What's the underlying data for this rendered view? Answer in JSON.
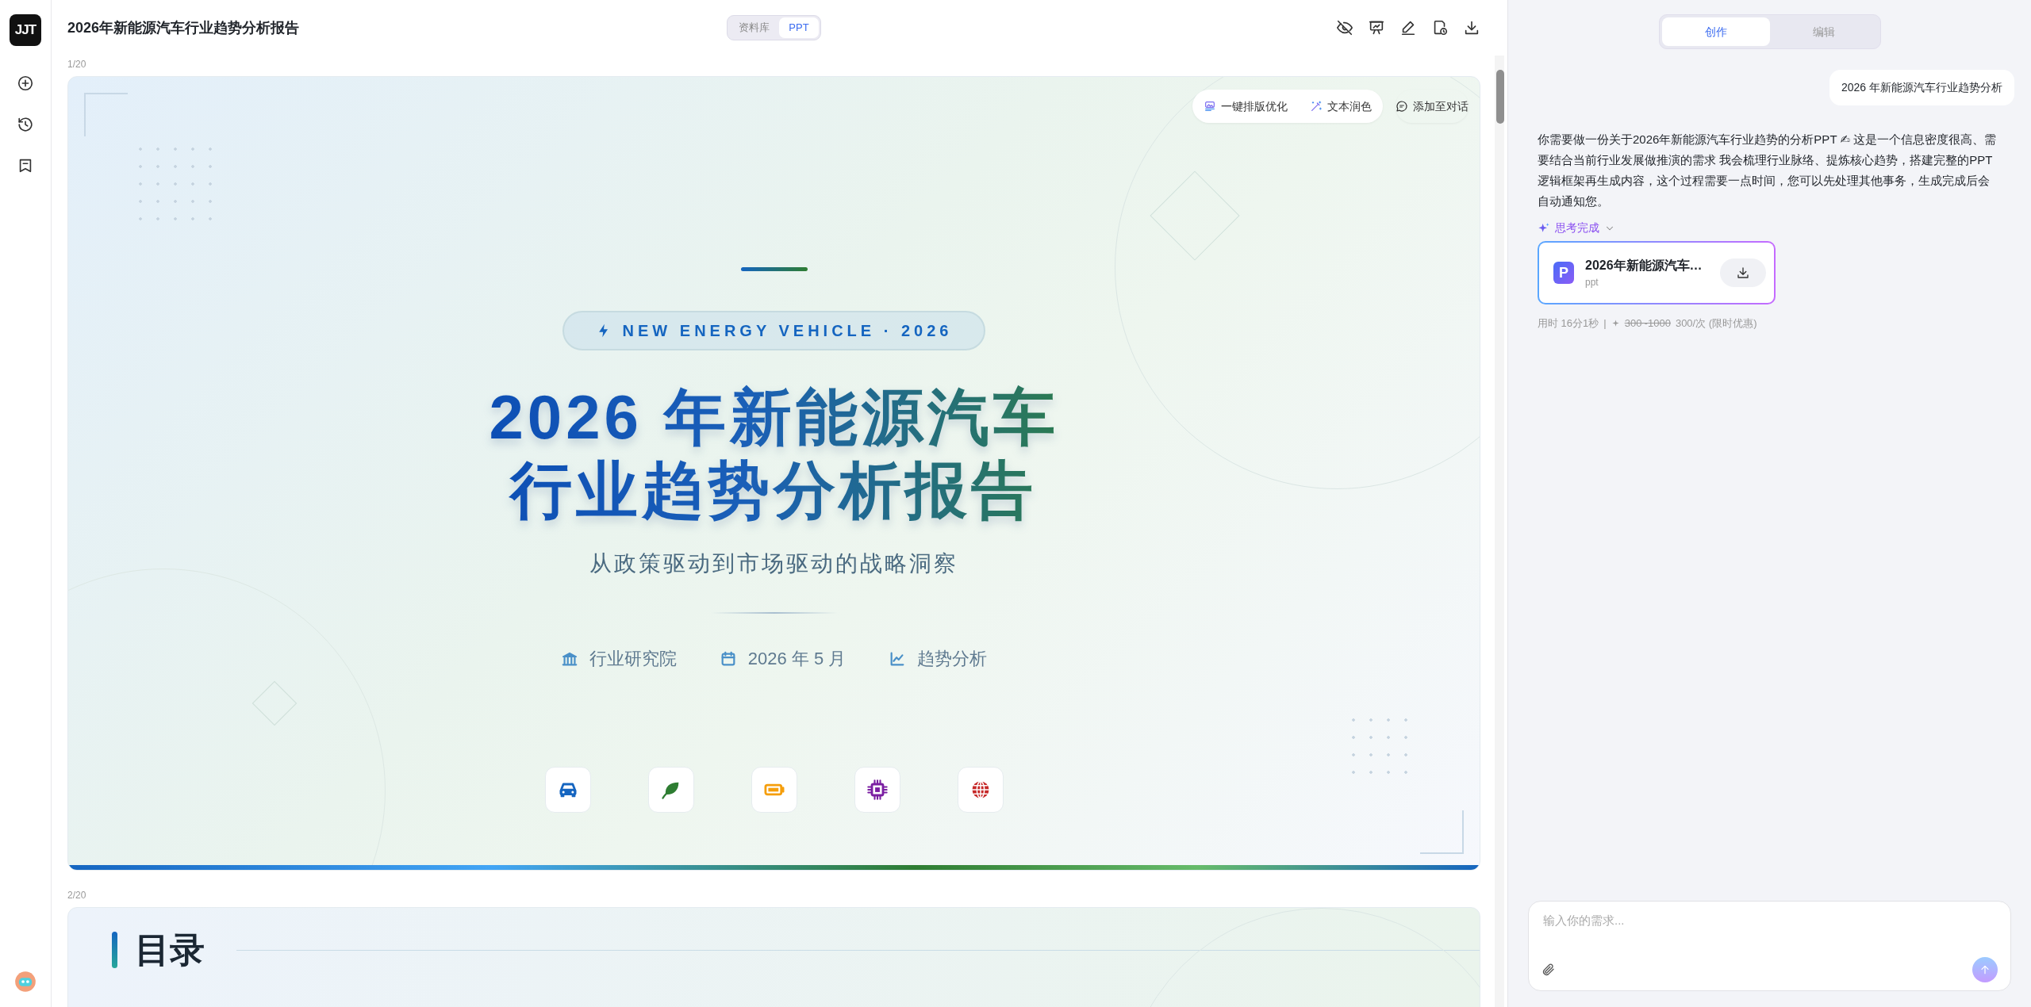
{
  "app": {
    "logo": "JJT"
  },
  "document": {
    "title": "2026年新能源汽车行业趋势分析报告"
  },
  "view_toggle": [
    {
      "label": "资料库",
      "selected": false
    },
    {
      "label": "PPT",
      "selected": true
    }
  ],
  "slides": [
    {
      "kind": "cover",
      "number": "1/20",
      "tools": [
        "一键排版优化",
        "文本润色"
      ],
      "add_to_chat": "添加至对话",
      "badge": "NEW ENERGY VEHICLE · 2026",
      "title_lines": [
        "2026 年新能源汽车",
        "行业趋势分析报告"
      ],
      "subtitle": "从政策驱动到市场驱动的战略洞察",
      "meta": [
        "行业研究院",
        "2026 年 5 月",
        "趋势分析"
      ],
      "tiles": [
        {
          "color": "#1565c0"
        },
        {
          "color": "#2e7d32"
        },
        {
          "color": "#f59e0b"
        },
        {
          "color": "#7b1fa2"
        },
        {
          "color": "#c62828"
        }
      ]
    },
    {
      "kind": "toc",
      "number": "2/20",
      "heading": "目录"
    }
  ],
  "assistant": {
    "tabs": [
      {
        "label": "创作",
        "selected": true
      },
      {
        "label": "编辑",
        "selected": false
      }
    ],
    "messages": [
      {
        "kind": "user",
        "text": "2026 年新能源汽车行业趋势分析"
      },
      {
        "kind": "assistant",
        "text": "你需要做一份关于2026年新能源汽车行业趋势的分析PPT ✍ 这是一个信息密度很高、需要结合当前行业发展做推演的需求 我会梳理行业脉络、提炼核心趋势，搭建完整的PPT逻辑框架再生成内容，这个过程需要一点时间，您可以先处理其他事务，生成完成后会自动通知您。",
        "thinking": "思考完成",
        "file": {
          "name": "2026年新能源汽车…",
          "type": "ppt",
          "icon": "P"
        },
        "usage": {
          "time": "用时 16分1秒",
          "separator": "|",
          "old_price": "300~1000",
          "price": "300/次 (限时优惠)"
        }
      }
    ]
  },
  "composer": {
    "placeholder": "输入你的需求..."
  }
}
